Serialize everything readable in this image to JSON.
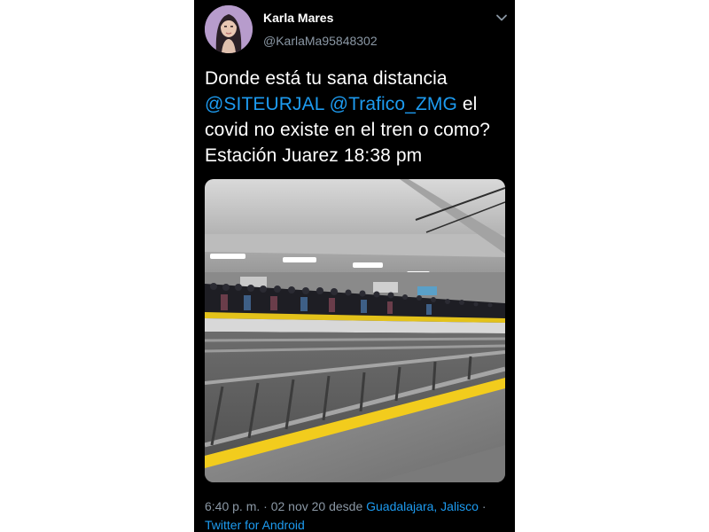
{
  "tweet": {
    "author": {
      "display_name": "Karla Mares",
      "handle": "@KarlaMa95848302"
    },
    "text": {
      "line1": "Donde está tu sana distancia",
      "mention1": "@SITEURJAL",
      "mention2": "@Trafico_ZMG",
      "after_mentions": " el",
      "line3": "covid no existe en el tren o como?",
      "line4": "Estación Juarez 18:38 pm"
    },
    "meta": {
      "time_date": "6:40 p. m. · 02 nov 20 desde ",
      "location": "Guadalajara, Jalisco",
      "separator": " ·",
      "client": "Twitter for Android"
    }
  },
  "icons": {
    "more_menu": "chevron-down-icon",
    "avatar": "profile-avatar"
  },
  "colors": {
    "background": "#000000",
    "text": "#ffffff",
    "secondary": "#8b98a5",
    "link": "#1d9bf0"
  }
}
